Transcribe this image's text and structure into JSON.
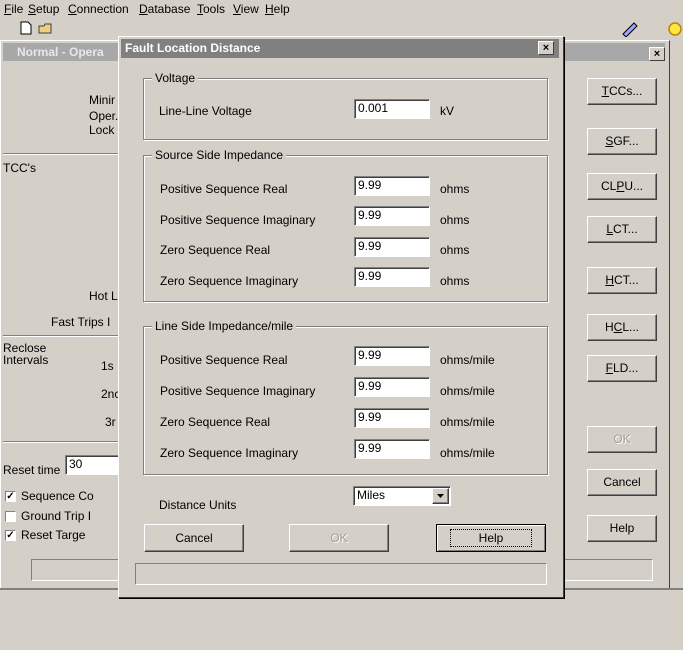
{
  "menubar": {
    "items": [
      {
        "label": "File",
        "key": "F",
        "rest": "ile"
      },
      {
        "label": "Setup",
        "key": "S",
        "rest": "etup"
      },
      {
        "label": "Connection",
        "key": "C",
        "rest": "onnection"
      },
      {
        "label": "Database",
        "key": "D",
        "rest": "atabase"
      },
      {
        "label": "Tools",
        "key": "T",
        "rest": "ools"
      },
      {
        "label": "View",
        "key": "V",
        "rest": "iew"
      },
      {
        "label": "Help",
        "key": "H",
        "rest": "elp"
      }
    ]
  },
  "back_window": {
    "title": "Normal - Opera",
    "labels": {
      "minimum": "Minir",
      "operations": "Oper.",
      "lockout": "Lock",
      "tccs": "TCC's",
      "hot_line": "Hot L",
      "fast_trips": "Fast Trips I",
      "reclose": "Reclose",
      "intervals": "Intervals",
      "first": "1s",
      "second": "2nc",
      "third": "3r",
      "reset_time": "Reset time",
      "reset_time_value": "30",
      "sequence": "Sequence Co",
      "ground_trip": "Ground Trip I",
      "reset_target": "Reset Targe"
    },
    "checkboxes": {
      "sequence": true,
      "ground_trip": false,
      "reset_target": true
    },
    "buttons": {
      "tccs": {
        "pre": "",
        "key": "T",
        "post": "CCs..."
      },
      "sgf": {
        "pre": "",
        "key": "S",
        "post": "GF..."
      },
      "clpu": {
        "pre": "CL",
        "key": "P",
        "post": "U..."
      },
      "lct": {
        "pre": "",
        "key": "L",
        "post": "CT..."
      },
      "hct": {
        "pre": "",
        "key": "H",
        "post": "CT..."
      },
      "hcl": {
        "pre": "H",
        "key": "C",
        "post": "L..."
      },
      "fld": {
        "pre": "",
        "key": "F",
        "post": "LD..."
      },
      "ok": "OK",
      "cancel": "Cancel",
      "help": "Help"
    },
    "close_glyph": "×"
  },
  "dialog": {
    "title": "Fault Location Distance",
    "close_glyph": "×",
    "voltage": {
      "group_title": "Voltage",
      "label": "Line-Line Voltage",
      "value": "0.001",
      "unit": "kV"
    },
    "source_side": {
      "group_title": "Source Side Impedance",
      "rows": [
        {
          "label": "Positive Sequence Real",
          "value": "9.99",
          "unit": "ohms"
        },
        {
          "label": "Positive Sequence Imaginary",
          "value": "9.99",
          "unit": "ohms"
        },
        {
          "label": "Zero Sequence Real",
          "value": "9.99",
          "unit": "ohms"
        },
        {
          "label": "Zero Sequence Imaginary",
          "value": "9.99",
          "unit": "ohms"
        }
      ]
    },
    "line_side": {
      "group_title": "Line Side Impedance/mile",
      "rows": [
        {
          "label": "Positive Sequence Real",
          "value": "9.99",
          "unit": "ohms/mile"
        },
        {
          "label": "Positive Sequence Imaginary",
          "value": "9.99",
          "unit": "ohms/mile"
        },
        {
          "label": "Zero Sequence Real",
          "value": "9.99",
          "unit": "ohms/mile"
        },
        {
          "label": "Zero Sequence Imaginary",
          "value": "9.99",
          "unit": "ohms/mile"
        }
      ]
    },
    "distance_units": {
      "label": "Distance Units",
      "selected": "Miles"
    },
    "buttons": {
      "cancel": "Cancel",
      "ok": "OK",
      "help": "Help"
    }
  },
  "icons": [
    "new-file-icon",
    "open-folder-icon",
    "edit-pencil-icon",
    "lightbulb-icon"
  ]
}
